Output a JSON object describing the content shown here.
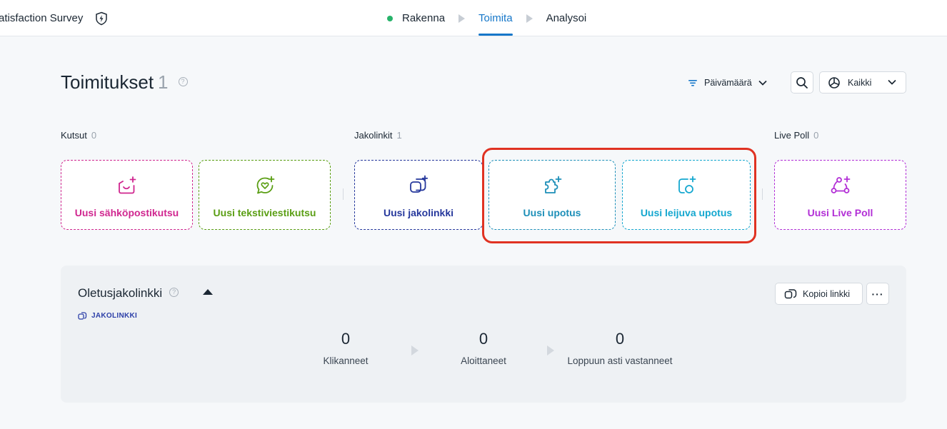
{
  "header": {
    "title": "atisfaction Survey",
    "steps": [
      {
        "label": "Rakenna"
      },
      {
        "label": "Toimita"
      },
      {
        "label": "Analysoi"
      }
    ]
  },
  "page": {
    "title": "Toimitukset",
    "count": "1",
    "help_glyph": "?"
  },
  "toolbar": {
    "sort_label": "Päivämäärä",
    "filter_label": "Kaikki"
  },
  "groups": {
    "invites": {
      "label": "Kutsut",
      "count": "0"
    },
    "links": {
      "label": "Jakolinkit",
      "count": "1"
    },
    "livepoll": {
      "label": "Live Poll",
      "count": "0"
    }
  },
  "cards": [
    {
      "label": "Uusi sähköpostikutsu",
      "color": "#d0268f"
    },
    {
      "label": "Uusi tekstiviestikutsu",
      "color": "#5a9e13"
    },
    {
      "label": "Uusi jakolinkki",
      "color": "#26389c"
    },
    {
      "label": "Uusi upotus",
      "color": "#1d8fb8"
    },
    {
      "label": "Uusi leijuva upotus",
      "color": "#14a7cf"
    },
    {
      "label": "Uusi Live Poll",
      "color": "#b22fd6"
    }
  ],
  "highlight_color": "#e03222",
  "panel": {
    "title": "Oletusjakolinkki",
    "tag": "JAKOLINKKI",
    "copy_label": "Kopioi linkki",
    "more_label": "···",
    "stats": [
      {
        "value": "0",
        "label": "Klikanneet"
      },
      {
        "value": "0",
        "label": "Aloittaneet"
      },
      {
        "value": "0",
        "label": "Loppuun asti vastanneet"
      }
    ]
  }
}
